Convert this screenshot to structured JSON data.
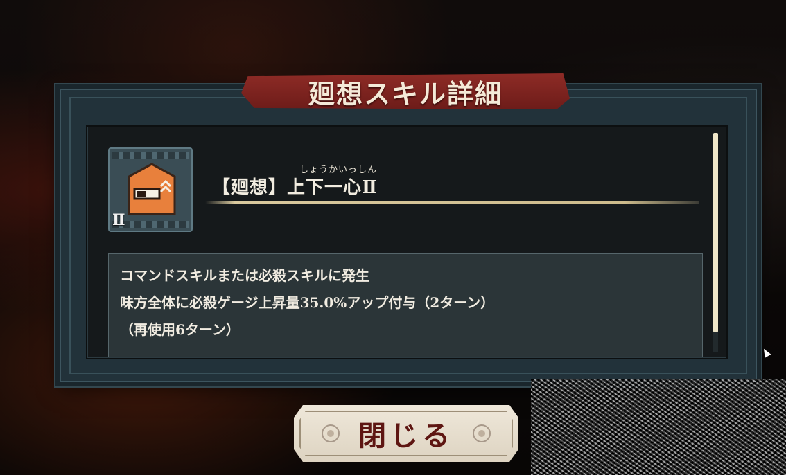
{
  "dialog": {
    "title": "廻想スキル詳細"
  },
  "skill": {
    "icon": "orange-pentagon-gauge-up-icon",
    "rank": "Ⅱ",
    "name": "【廻想】上下一心Ⅱ",
    "ruby": "しょうかいっしん",
    "description": [
      "コマンドスキルまたは必殺スキルに発生",
      "味方全体に必殺ゲージ上昇量35.0%アップ付与（2ターン）",
      "（再使用6ターン）"
    ]
  },
  "buttons": {
    "close_label": "閉じる"
  },
  "colors": {
    "title_banner": "#8e2b26",
    "skill_icon_orange": "#e8803c",
    "close_text": "#5e1612",
    "scroll_thumb": "#efe6c8"
  }
}
